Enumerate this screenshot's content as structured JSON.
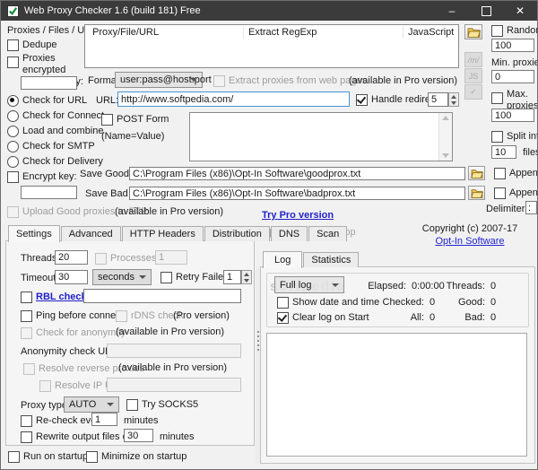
{
  "titlebar": {
    "title": "Web Proxy Checker 1.6 (build 181) Free",
    "minimize_glyph": "–",
    "close_glyph": "✕"
  },
  "shared": {
    "available_pro": "(available in Pro version)",
    "pro_version": "(Pro version)",
    "append": "Append",
    "minutes": "minutes"
  },
  "top": {
    "proxies_files_urls": "Proxies / Files / URLs:",
    "dedupe": "Dedupe",
    "proxies_encrypted": "Proxies encrypted using the key:",
    "encryption_key_value": "",
    "list": {
      "columns": [
        "Proxy/File/URL",
        "Extract RegExp",
        "JavaScript"
      ]
    },
    "side_buttons": {
      "regex": "/m/",
      "js": "JS",
      "check": "✓"
    },
    "format_label": "Format:",
    "format_value": "user:pass@host:port",
    "extract_proxies": "Extract proxies from web pages",
    "url_label": "URL:",
    "url_value": "http://www.softpedia.com/",
    "handle_redirects": "Handle redirects",
    "redirects_value": "5",
    "post_form": "POST Form",
    "post_form_hint": "(Name=Value)",
    "check_modes": [
      "Check for URL",
      "Check for Connect",
      "Load and combine",
      "Check for SMTP",
      "Check for Delivery"
    ],
    "encrypt_key": "Encrypt key:",
    "encrypt_key_value": "",
    "save_good_label": "Save Good to:",
    "save_good_value": "C:\\Program Files (x86)\\Opt-In Software\\goodprox.txt",
    "save_bad_label": "Save Bad to:",
    "save_bad_value": "C:\\Program Files (x86)\\Opt-In Software\\badprox.txt",
    "delimiter_label": "Delimiter:",
    "delimiter_value": ":",
    "upload_ftp": "Upload Good proxies to FTP",
    "try_pro": "Try Pro version",
    "right_panel": {
      "random": "Random",
      "random_value": "100",
      "min_proxies": "Min. proxies:",
      "min_value": "0",
      "max_proxies": "Max. proxies:",
      "max_value": "100",
      "split_into": "Split into",
      "split_value": "10",
      "files": "files"
    }
  },
  "settings": {
    "tabs": [
      "Settings",
      "Advanced",
      "HTTP Headers",
      "Distribution",
      "DNS",
      "Scan"
    ],
    "threads_label": "Threads:",
    "threads_value": "20",
    "processes_label": "Processes:",
    "processes_value": "1",
    "timeout_label": "Timeout:",
    "timeout_value": "30",
    "timeout_unit": "seconds",
    "retry_failed": "Retry Failed:",
    "retry_value": "1",
    "rbl_check": "RBL check:",
    "rbl_value": "",
    "ping_before": "Ping before connect",
    "rdns_check": "rDNS check",
    "check_anonymity": "Check for anonymity",
    "anonymity_url_label": "Anonymity check URL:",
    "anonymity_url_value": "",
    "resolve_reverse": "Resolve reverse proxies",
    "resolve_ip_label": "Resolve IP URL:",
    "resolve_ip_value": "",
    "proxy_type_label": "Proxy type:",
    "proxy_type_value": "AUTO",
    "try_socks5": "Try SOCKS5",
    "recheck_every": "Re-check every",
    "recheck_value": "1",
    "rewrite_every": "Rewrite output files every",
    "rewrite_value": "30",
    "run_on_startup": "Run on startup",
    "minimize_on_startup": "Minimize on startup"
  },
  "runner": {
    "start": "Start",
    "stop": "Stop",
    "copyright": "Copyright (c) 2007-17",
    "company": "Opt-In Software",
    "tabs": [
      "Log",
      "Statistics"
    ],
    "log_mode": "Full log",
    "stats": {
      "elapsed_label": "Elapsed:",
      "elapsed_value": "0:00:00",
      "threads_label": "Threads:",
      "threads_value": "0",
      "checked_label": "Checked:",
      "checked_value": "0",
      "good_label": "Good:",
      "good_value": "0",
      "all_label": "All:",
      "all_value": "0",
      "bad_label": "Bad:",
      "bad_value": "0"
    },
    "show_date": "Show date and time",
    "clear_log": "Clear log on Start"
  },
  "watermark": "softpedia",
  "colors": {
    "titlebar": "#3b3b3b",
    "link_blue": "#2323d0",
    "folder_yellow": "#f5c84c"
  }
}
